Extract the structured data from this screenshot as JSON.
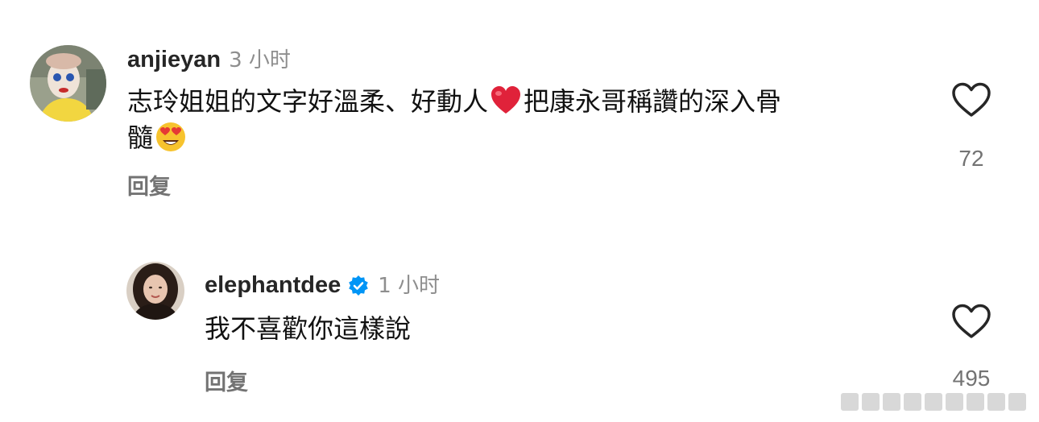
{
  "comments": [
    {
      "username": "anjieyan",
      "time": "3 小时",
      "verified": false,
      "text_line1_a": "志玲姐姐的文字好溫柔、好動人",
      "text_line1_emoji": "red-heart-emoji",
      "text_line1_b": "把康永哥稱讚的深入骨",
      "text_line2": "髓",
      "text_line2_emoji": "heart-eyes-emoji",
      "reply_label": "回复",
      "like_count": "72"
    },
    {
      "username": "elephantdee",
      "time": "1 小时",
      "verified": true,
      "text": "我不喜歡你這樣說",
      "reply_label": "回复",
      "like_count": "495"
    }
  ],
  "colors": {
    "username": "#262626",
    "meta": "#8e8e8e",
    "verified_badge": "#0095f6",
    "heart_emoji": "#e0223a"
  }
}
